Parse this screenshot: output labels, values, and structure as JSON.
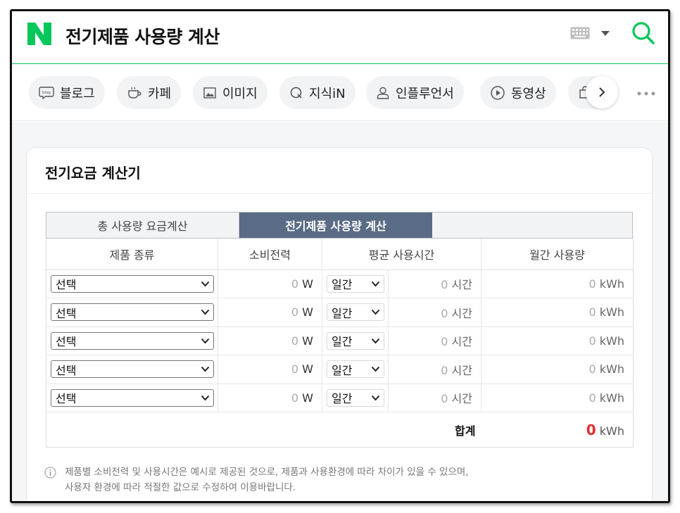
{
  "header": {
    "logo": "N",
    "query": "전기제품 사용량 계산",
    "icons": [
      "keyboard-icon",
      "chevron-down-icon",
      "search-icon"
    ],
    "brand_color": "#03c75a"
  },
  "tabs": [
    {
      "label": "블로그",
      "icon": "blog-icon"
    },
    {
      "label": "카페",
      "icon": "cup-icon"
    },
    {
      "label": "이미지",
      "icon": "image-icon"
    },
    {
      "label": "지식iN",
      "icon": "q-icon"
    },
    {
      "label": "인플루언서",
      "icon": "person-icon"
    },
    {
      "label": "동영상",
      "icon": "play-icon"
    }
  ],
  "card": {
    "title": "전기요금 계산기"
  },
  "calc": {
    "tabs": [
      "총 사용량 요금계산",
      "전기제품 사용량 계산"
    ],
    "active_tab": 1,
    "columns": [
      "제품 종류",
      "소비전력",
      "평균 사용시간",
      "월간 사용량"
    ],
    "rows": [
      {
        "product": "선택",
        "power": "0",
        "power_unit": "W",
        "period": "일간",
        "hours": "0",
        "hours_unit": "시간",
        "monthly": "0",
        "monthly_unit": "kWh"
      },
      {
        "product": "선택",
        "power": "0",
        "power_unit": "W",
        "period": "일간",
        "hours": "0",
        "hours_unit": "시간",
        "monthly": "0",
        "monthly_unit": "kWh"
      },
      {
        "product": "선택",
        "power": "0",
        "power_unit": "W",
        "period": "일간",
        "hours": "0",
        "hours_unit": "시간",
        "monthly": "0",
        "monthly_unit": "kWh"
      },
      {
        "product": "선택",
        "power": "0",
        "power_unit": "W",
        "period": "일간",
        "hours": "0",
        "hours_unit": "시간",
        "monthly": "0",
        "monthly_unit": "kWh"
      },
      {
        "product": "선택",
        "power": "0",
        "power_unit": "W",
        "period": "일간",
        "hours": "0",
        "hours_unit": "시간",
        "monthly": "0",
        "monthly_unit": "kWh"
      }
    ],
    "total_label": "합계",
    "total_value": "0",
    "total_unit": "kWh",
    "total_color": "#e32d2d"
  },
  "note": {
    "line1": "제품별 소비전력 및 사용시간은 예시로 제공된 것으로, 제품과 사용환경에 따라 차이가 있을 수 있으며,",
    "line2": "사용자 환경에 따라 적절한 값으로 수정하여 이용바랍니다."
  }
}
